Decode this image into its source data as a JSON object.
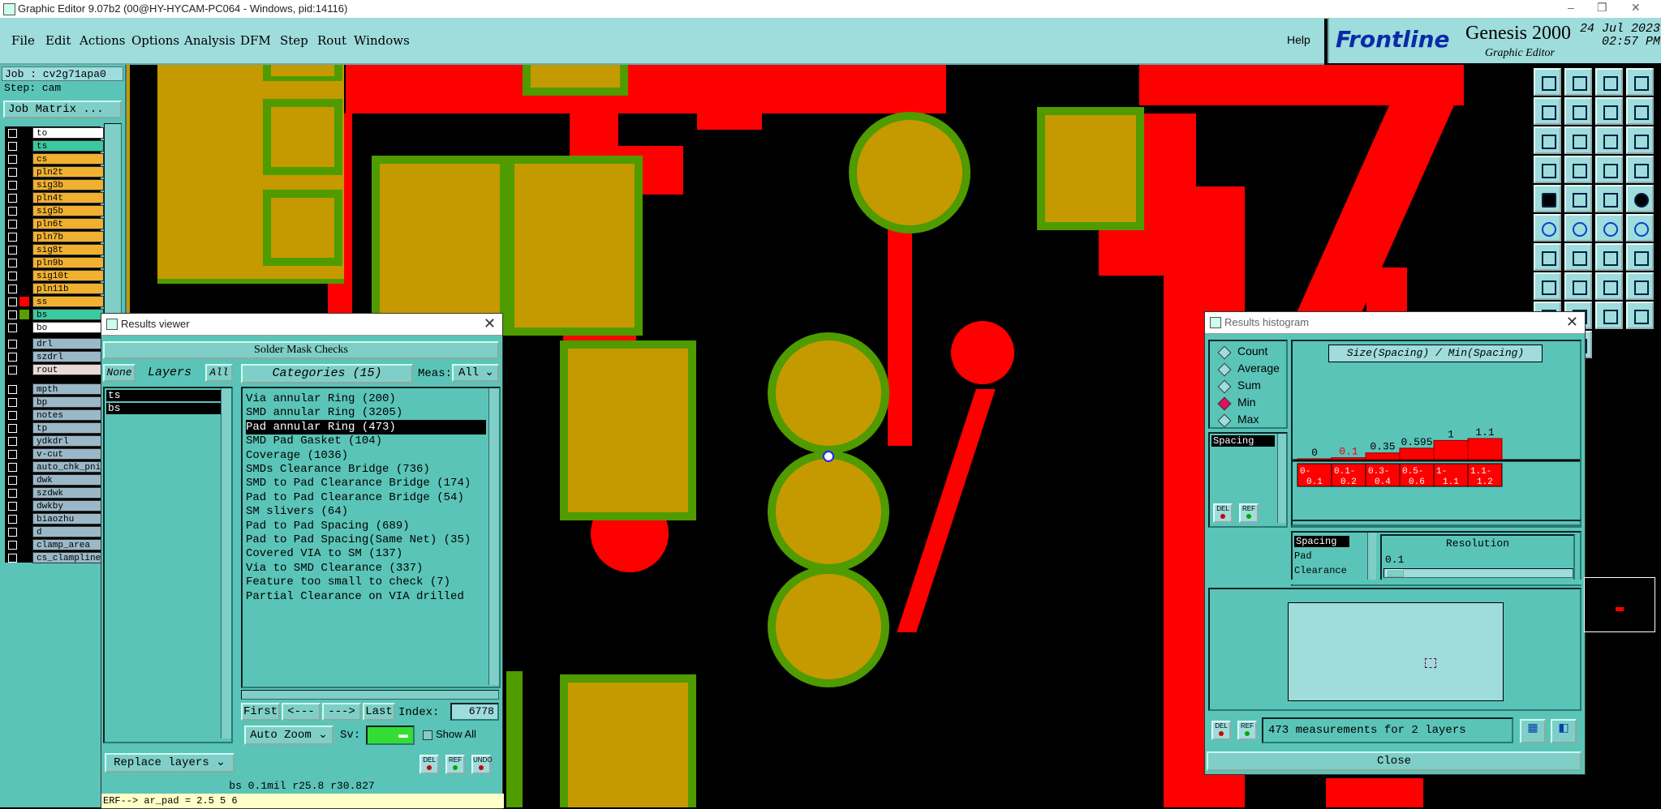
{
  "window": {
    "title": "Graphic Editor 9.07b2 (00@HY-HYCAM-PC064 - Windows, pid:14116)",
    "controls": [
      "–",
      "❐",
      "✕"
    ]
  },
  "menu": {
    "items": [
      "File",
      "Edit",
      "Actions",
      "Options",
      "Analysis",
      "DFM",
      "Step",
      "Rout",
      "Windows"
    ],
    "help": "Help"
  },
  "brand": {
    "logo": "Frontline",
    "product": "Genesis 2000",
    "subtitle": "Graphic Editor",
    "date": "24 Jul 2023",
    "time": "02:57 PM"
  },
  "job": {
    "job_label": "Job : cv2g71apa0",
    "step_label": "Step: cam",
    "job_matrix_button": "Job Matrix ..."
  },
  "layers": {
    "board": [
      {
        "name": "to",
        "color": "#ffffff",
        "swatch": "#000000"
      },
      {
        "name": "ts",
        "color": "#3cc8a0",
        "swatch": "#000000"
      },
      {
        "name": "cs",
        "color": "#f0b030",
        "swatch": "#000000"
      },
      {
        "name": "pln2t",
        "color": "#f0b030",
        "swatch": "#000000"
      },
      {
        "name": "sig3b",
        "color": "#f0b030",
        "swatch": "#000000"
      },
      {
        "name": "pln4t",
        "color": "#f0b030",
        "swatch": "#000000"
      },
      {
        "name": "sig5b",
        "color": "#f0b030",
        "swatch": "#000000"
      },
      {
        "name": "pln6t",
        "color": "#f0b030",
        "swatch": "#000000"
      },
      {
        "name": "pln7b",
        "color": "#f0b030",
        "swatch": "#000000"
      },
      {
        "name": "sig8t",
        "color": "#f0b030",
        "swatch": "#000000"
      },
      {
        "name": "pln9b",
        "color": "#f0b030",
        "swatch": "#000000"
      },
      {
        "name": "sig10t",
        "color": "#f0b030",
        "swatch": "#000000"
      },
      {
        "name": "pln11b",
        "color": "#f0b030",
        "swatch": "#000000"
      },
      {
        "name": "ss",
        "color": "#f0b030",
        "swatch": "#ff0000"
      },
      {
        "name": "bs",
        "color": "#3cc8a0",
        "swatch": "#5a9e00"
      },
      {
        "name": "bo",
        "color": "#ffffff",
        "swatch": "#000000"
      }
    ],
    "drill": [
      {
        "name": "drl",
        "color": "#9ab8c8"
      },
      {
        "name": "szdrl",
        "color": "#9ab8c8"
      },
      {
        "name": "rout",
        "color": "#e8d8d8"
      }
    ],
    "misc": [
      {
        "name": "mpth",
        "color": "#9ab8c8"
      },
      {
        "name": "bp",
        "color": "#9ab8c8"
      },
      {
        "name": "notes",
        "color": "#9ab8c8"
      },
      {
        "name": "tp",
        "color": "#9ab8c8"
      },
      {
        "name": "ydkdrl",
        "color": "#9ab8c8"
      },
      {
        "name": "v-cut",
        "color": "#9ab8c8"
      },
      {
        "name": "auto_chk_pni",
        "color": "#9ab8c8"
      },
      {
        "name": "dwk",
        "color": "#9ab8c8"
      },
      {
        "name": "szdwk",
        "color": "#9ab8c8"
      },
      {
        "name": "dwkby",
        "color": "#9ab8c8"
      },
      {
        "name": "biaozhu",
        "color": "#9ab8c8"
      },
      {
        "name": "d",
        "color": "#9ab8c8"
      },
      {
        "name": "clamp_area",
        "color": "#9ab8c8"
      },
      {
        "name": "cs_clampline",
        "color": "#9ab8c8"
      }
    ]
  },
  "results_viewer": {
    "title": "Results viewer",
    "header": "Solder Mask Checks",
    "none_button": "None",
    "layers_label": "Layers",
    "all_button": "All",
    "layer_list": [
      "ts",
      "bs"
    ],
    "categories_label": "Categories (15)",
    "meas_label": "Meas:",
    "meas_value": "All",
    "categories": [
      "Via annular Ring (200)",
      "SMD annular Ring (3205)",
      "Pad annular Ring (473)",
      "SMD Pad Gasket (104)",
      "Coverage (1036)",
      "SMDs Clearance Bridge (736)",
      "SMD to Pad Clearance Bridge (174)",
      "Pad to Pad Clearance Bridge (54)",
      "SM slivers (64)",
      "Pad to Pad Spacing (689)",
      "Pad to Pad Spacing(Same Net) (35)",
      "Covered VIA to SM (137)",
      "Via to SMD Clearance (337)",
      "Feature too small to check (7)",
      "Partial Clearance on VIA drilled"
    ],
    "selected_category": "Pad annular Ring (473)",
    "first": "First",
    "prev": "<---",
    "next": "--->",
    "last": "Last",
    "index_label": "Index:",
    "index_value": "6778",
    "auto_zoom": "Auto Zoom",
    "sv_label": "Sv:",
    "show_all": "Show All",
    "replace_layers": "Replace layers",
    "del": "DEL",
    "ref": "REF",
    "undo": "UNDO",
    "status": "bs 0.1mil  r25.8  r30.827",
    "erf": "ERF--> ar_pad = 2.5 5 6"
  },
  "histogram": {
    "title": "Results histogram",
    "modes": [
      "Count",
      "Average",
      "Sum",
      "Min",
      "Max"
    ],
    "selected_mode": "Min",
    "chart_title": "Size(Spacing) / Min(Spacing)",
    "list_item": "Spacing",
    "bar_labels": [
      "0",
      "0.1",
      "0.35",
      "0.595",
      "1",
      "1.1"
    ],
    "bins": [
      "0-\n0.1",
      "0.1-\n0.2",
      "0.3-\n0.4",
      "0.5-\n0.6",
      "1-\n1.1",
      "1.1-\n1.2"
    ],
    "attributes": [
      "Spacing",
      "Pad",
      "Clearance"
    ],
    "resolution_label": "Resolution",
    "resolution_value": "0.1",
    "summary": "473 measurements for 2 layers",
    "close": "Close",
    "del": "DEL",
    "ref": "REF"
  },
  "chart_data": {
    "type": "bar",
    "title": "Size(Spacing) / Min(Spacing)",
    "categories": [
      "0-0.1",
      "0.1-0.2",
      "0.3-0.4",
      "0.5-0.6",
      "1-1.1",
      "1.1-1.2"
    ],
    "values": [
      0,
      0.1,
      0.35,
      0.595,
      1,
      1.1
    ]
  }
}
